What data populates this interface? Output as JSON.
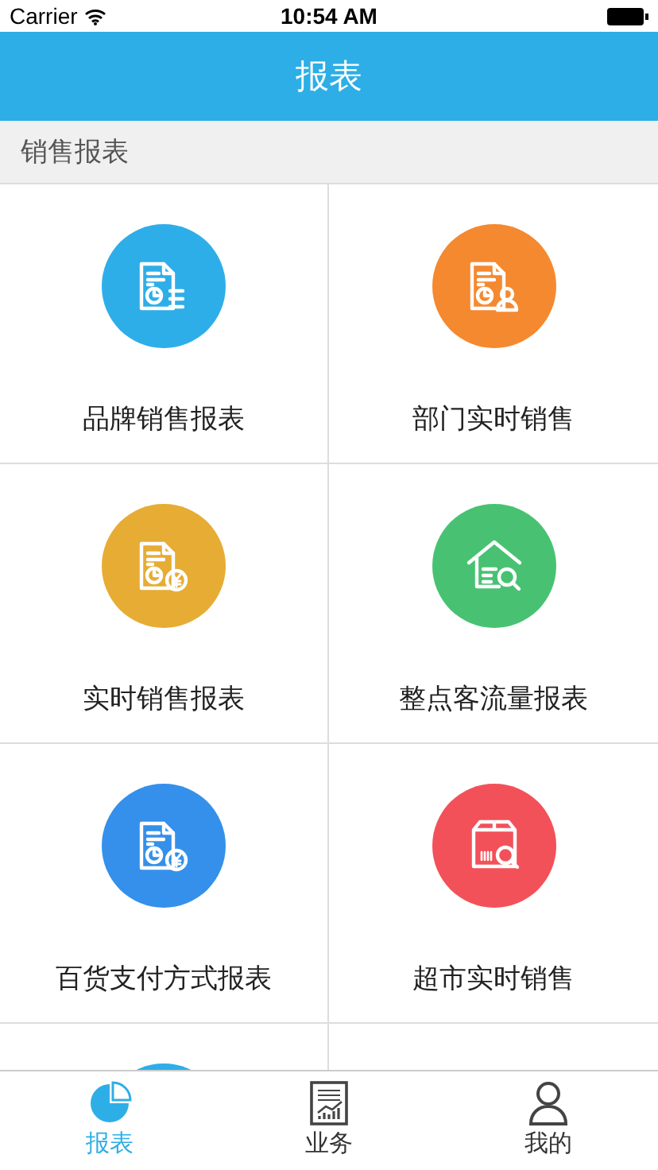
{
  "status_bar": {
    "carrier": "Carrier",
    "time": "10:54 AM"
  },
  "nav": {
    "title": "报表"
  },
  "section": {
    "title": "销售报表"
  },
  "items": [
    {
      "label": "品牌销售报表",
      "kind": "list",
      "color": "#2eaee8"
    },
    {
      "label": "部门实时销售",
      "kind": "person",
      "color": "#f5892f"
    },
    {
      "label": "实时销售报表",
      "kind": "yen",
      "color": "#e6ac34"
    },
    {
      "label": "整点客流量报表",
      "kind": "house",
      "color": "#48c272"
    },
    {
      "label": "百货支付方式报表",
      "kind": "yen",
      "color": "#3490ea"
    },
    {
      "label": "超市实时销售",
      "kind": "box",
      "color": "#f25159"
    },
    {
      "color": "#2eaee8"
    }
  ],
  "tabs": [
    {
      "label": "报表",
      "kind": "pie",
      "selected": true
    },
    {
      "label": "业务",
      "kind": "chart",
      "selected": false
    },
    {
      "label": "我的",
      "kind": "person",
      "selected": false
    }
  ]
}
